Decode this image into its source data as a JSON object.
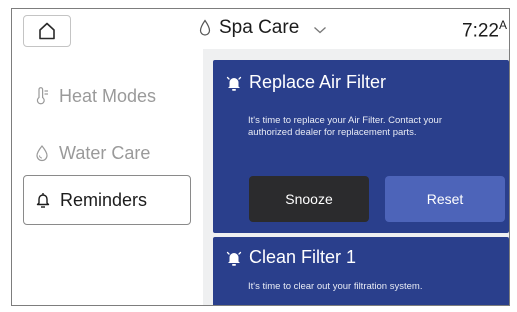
{
  "header": {
    "title": "Spa Care",
    "time": "7:22",
    "time_suffix": "A"
  },
  "sidebar": {
    "items": [
      {
        "label": "Heat Modes",
        "icon": "thermometer-icon",
        "active": false
      },
      {
        "label": "Water Care",
        "icon": "water-care-icon",
        "active": false
      },
      {
        "label": "Reminders",
        "icon": "bell-icon",
        "active": true
      }
    ]
  },
  "reminders": [
    {
      "title": "Replace Air Filter",
      "message": "It's time to replace your Air Filter. Contact your authorized dealer for replacement parts.",
      "snooze_label": "Snooze",
      "reset_label": "Reset"
    },
    {
      "title": "Clean Filter 1",
      "message": "It's time to clear out your filtration system."
    }
  ],
  "colors": {
    "card_bg": "#2a3f8c",
    "snooze_bg": "#2b2b2d",
    "reset_bg": "#4d64b9",
    "content_bg": "#eff0f1"
  }
}
